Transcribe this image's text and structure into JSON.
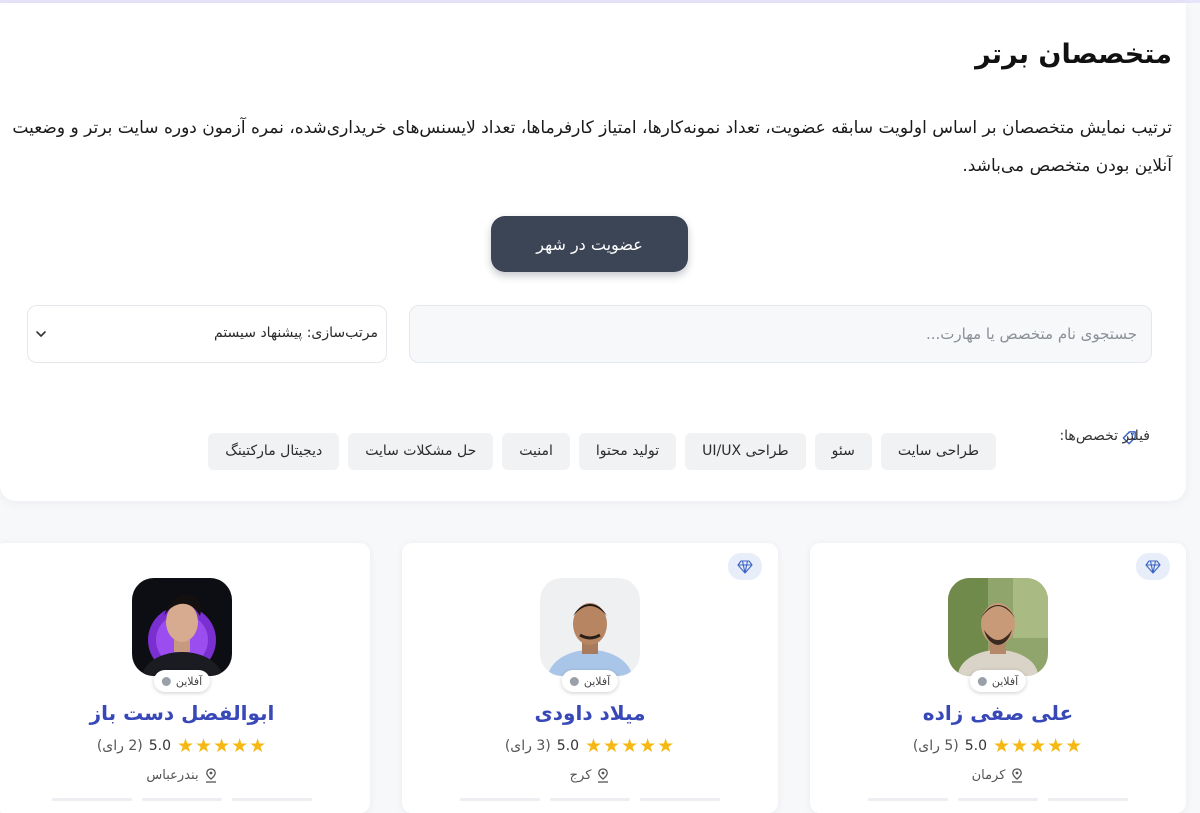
{
  "header": {
    "title": "متخصصان برتر",
    "description": "ترتیب نمایش متخصصان بر اساس اولویت سابقه عضویت، تعداد نمونه‌کارها، امتیاز کارفرماها، تعداد لایسنس‌های خریداری‌شده، نمره آزمون دوره سایت برتر و وضعیت آنلاین بودن متخصص می‌باشد."
  },
  "join_button": {
    "label": "عضویت در شهر"
  },
  "search": {
    "placeholder": "جستجوی نام متخصص یا مهارت...",
    "value": ""
  },
  "sort": {
    "label": "مرتب‌سازی: پیشنهاد سیستم"
  },
  "filters": {
    "label": "فیلتر تخصص‌ها:",
    "chips": [
      "طراحی سایت",
      "سئو",
      "طراحی UI/UX",
      "تولید محتوا",
      "امنیت",
      "حل مشکلات سایت",
      "دیجیتال مارکتینگ"
    ]
  },
  "experts": [
    {
      "name": "علی صفی زاده",
      "status": "آفلاین",
      "stars": 5,
      "score": "5.0",
      "votes": "(5 رای)",
      "city": "کرمان",
      "premium": true
    },
    {
      "name": "میلاد داودی",
      "status": "آفلاین",
      "stars": 5,
      "score": "5.0",
      "votes": "(3 رای)",
      "city": "کرج",
      "premium": true
    },
    {
      "name": "ابوالفضل دست باز",
      "status": "آفلاین",
      "stars": 5,
      "score": "5.0",
      "votes": "(2 رای)",
      "city": "بندرعباس",
      "premium": false
    }
  ],
  "colors": {
    "accent": "#3848b8",
    "button": "#3c4556",
    "star": "#f5b814"
  }
}
